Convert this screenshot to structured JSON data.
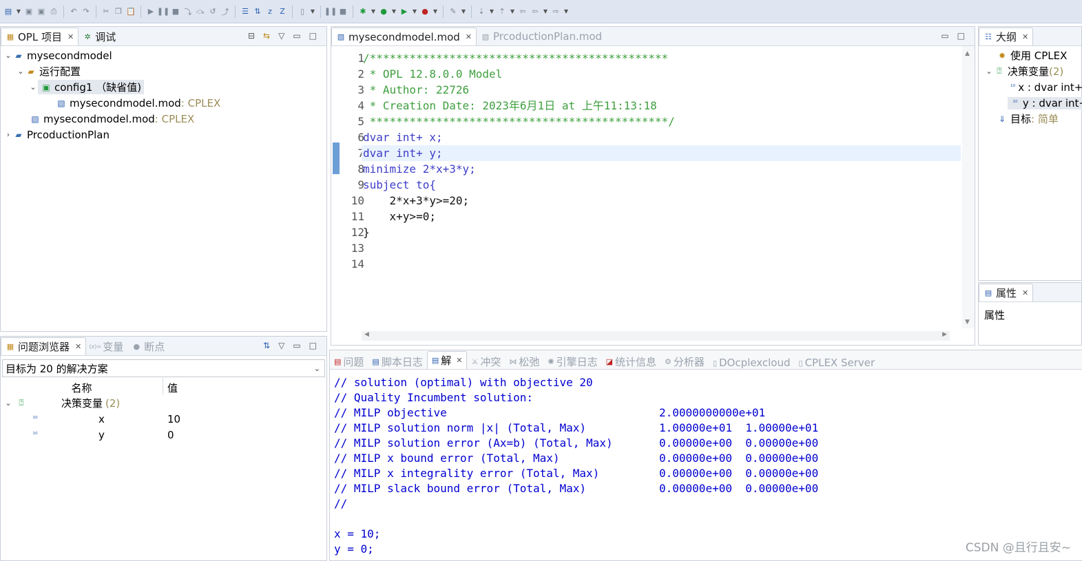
{
  "toolbar": {
    "icons": [
      "new-icon",
      "save-icon",
      "save-all-icon",
      "print-icon",
      "undo-icon",
      "redo-icon",
      "cut-icon",
      "copy-icon",
      "paste-icon",
      "resume-icon",
      "suspend-icon",
      "terminate-icon",
      "step-into-icon",
      "step-over-icon",
      "step-return-icon",
      "drop-frame-icon",
      "format-icon",
      "organize-icon",
      "z-icon",
      "zz-icon",
      "db-icon",
      "pause-icon",
      "stop-icon",
      "debug-icon",
      "run-icon",
      "run-config-icon",
      "profile-icon",
      "tools-icon",
      "nav-icon",
      "back-icon",
      "forward-icon"
    ]
  },
  "project_panel": {
    "tabs": [
      {
        "label": "OPL 项目",
        "icon": "project-icon"
      },
      {
        "label": "调试",
        "icon": "debug-icon"
      }
    ],
    "tree": [
      {
        "label": "mysecondmodel",
        "suffix": ""
      },
      {
        "label": "运行配置",
        "suffix": ""
      },
      {
        "label": "config1 （缺省值)",
        "suffix": ""
      },
      {
        "label": "mysecondmodel.mod",
        "suffix": " : CPLEX"
      },
      {
        "label": "mysecondmodel.mod",
        "suffix": " : CPLEX"
      },
      {
        "label": "PrcoductionPlan",
        "suffix": ""
      }
    ]
  },
  "editor": {
    "tabs": [
      {
        "label": "mysecondmodel.mod",
        "active": true
      },
      {
        "label": "PrcoductionPlan.mod",
        "active": false
      }
    ],
    "line_numbers": [
      "1",
      "2",
      "3",
      "4",
      "5",
      "6",
      "7",
      "8",
      "9",
      "10",
      "11",
      "12",
      "13",
      "14"
    ],
    "code": [
      "/*********************************************",
      " * OPL 12.8.0.0 Model",
      " * Author: 22726",
      " * Creation Date: 2023年6月1日 at 上午11:13:18",
      " *********************************************/",
      "dvar int+ x;",
      "dvar int+ y;",
      "minimize 2*x+3*y;",
      "subject to{",
      "    2*x+3*y>=20;",
      "    x+y>=0;",
      "}",
      "",
      ""
    ],
    "highlighted_line": 7
  },
  "outline_panel": {
    "title": "大纲",
    "items": [
      {
        "label": "使用 CPLEX",
        "suffix": ""
      },
      {
        "label": "决策变量",
        "suffix": " (2)"
      },
      {
        "label": "x : dvar int+",
        "suffix": ""
      },
      {
        "label": "y : dvar int+",
        "suffix": ""
      },
      {
        "label": "目标",
        "suffix": " : 简单"
      }
    ]
  },
  "properties_panel": {
    "title": "属性",
    "content": "属性"
  },
  "problem_browser": {
    "tabs": [
      {
        "label": "问题浏览器",
        "active": true
      },
      {
        "label": "变量",
        "active": false
      },
      {
        "label": "断点",
        "active": false
      }
    ],
    "selection": "目标为 20 的解决方案",
    "col_name": "名称",
    "col_value": "值",
    "group": {
      "label": "决策变量",
      "count": "(2)"
    },
    "rows": [
      {
        "name": "x",
        "value": "10"
      },
      {
        "name": "y",
        "value": "0"
      }
    ]
  },
  "console": {
    "tabs": [
      "问题",
      "脚本日志",
      "解",
      "冲突",
      "松弛",
      "引擎日志",
      "统计信息",
      "分析器",
      "DOcplexcloud",
      "CPLEX Server"
    ],
    "active_tab": "解",
    "output": [
      "// solution (optimal) with objective 20",
      "// Quality Incumbent solution:",
      "// MILP objective                                2.0000000000e+01",
      "// MILP solution norm |x| (Total, Max)           1.00000e+01  1.00000e+01",
      "// MILP solution error (Ax=b) (Total, Max)       0.00000e+00  0.00000e+00",
      "// MILP x bound error (Total, Max)               0.00000e+00  0.00000e+00",
      "// MILP x integrality error (Total, Max)         0.00000e+00  0.00000e+00",
      "// MILP slack bound error (Total, Max)           0.00000e+00  0.00000e+00",
      "//",
      "",
      "x = 10;",
      "y = 0;"
    ]
  },
  "watermark": "CSDN @且行且安~"
}
